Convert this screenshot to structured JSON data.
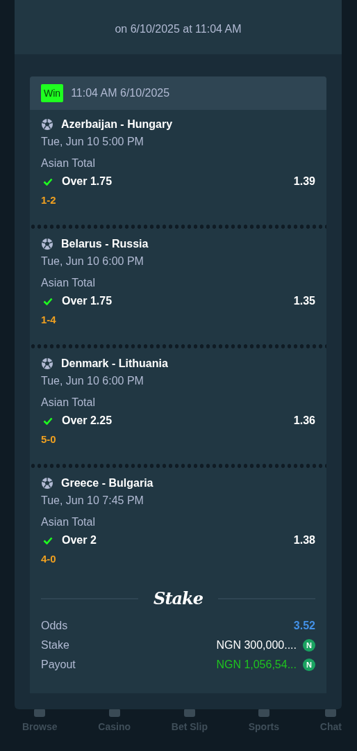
{
  "header": {
    "text": "on 6/10/2025 at 11:04 AM"
  },
  "ticket": {
    "status": {
      "label": "Win",
      "kind": "win"
    },
    "time": "11:04 AM 6/10/2025",
    "legs": [
      {
        "match": "Azerbaijan - Hungary",
        "start": "Tue, Jun 10 5:00 PM",
        "market": "Asian Total",
        "selection": "Over 1.75",
        "odds": "1.39",
        "won": true,
        "score": "1-2"
      },
      {
        "match": "Belarus - Russia",
        "start": "Tue, Jun 10 6:00 PM",
        "market": "Asian Total",
        "selection": "Over 1.75",
        "odds": "1.35",
        "won": true,
        "score": "1-4"
      },
      {
        "match": "Denmark - Lithuania",
        "start": "Tue, Jun 10 6:00 PM",
        "market": "Asian Total",
        "selection": "Over 2.25",
        "odds": "1.36",
        "won": true,
        "score": "5-0"
      },
      {
        "match": "Greece - Bulgaria",
        "start": "Tue, Jun 10 7:45 PM",
        "market": "Asian Total",
        "selection": "Over 2",
        "odds": "1.38",
        "won": true,
        "score": "4-0"
      }
    ],
    "logo": "Stake",
    "summary": [
      {
        "label": "Odds",
        "value": "3.52",
        "kind": "odds"
      },
      {
        "label": "Stake",
        "value": "NGN 300,000....",
        "kind": "amount",
        "currency": "N"
      },
      {
        "label": "Payout",
        "value": "NGN 1,056,54...",
        "kind": "payout",
        "currency": "N"
      }
    ]
  },
  "nav": [
    {
      "label": "Browse"
    },
    {
      "label": "Casino"
    },
    {
      "label": "Bet Slip"
    },
    {
      "label": "Sports"
    },
    {
      "label": "Chat"
    }
  ]
}
